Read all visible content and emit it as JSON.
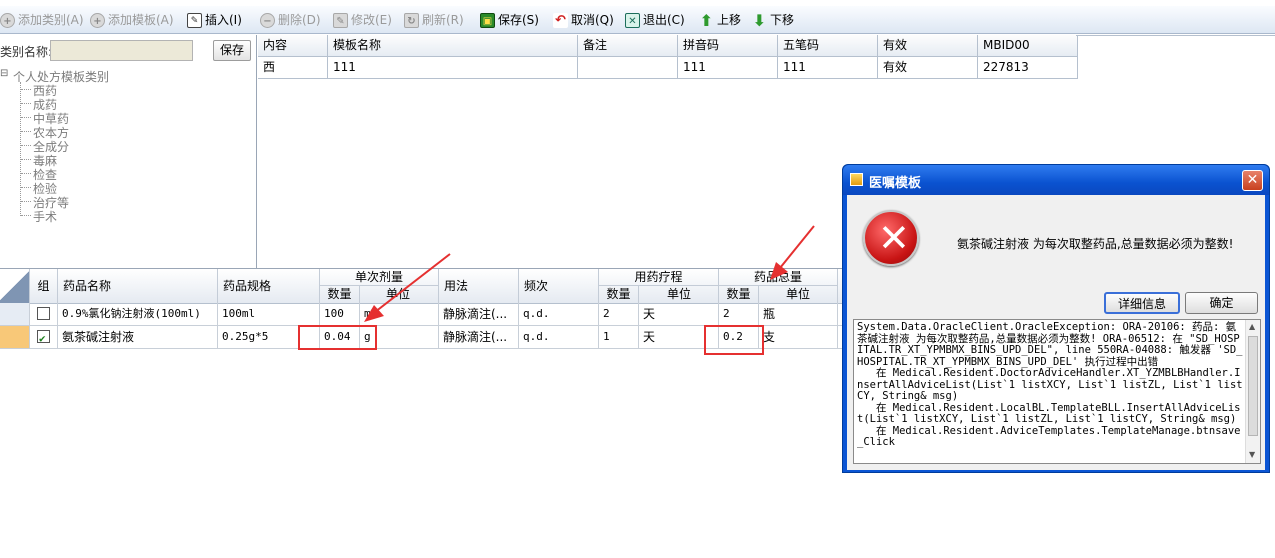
{
  "toolbar": {
    "add_category": "添加类别(A)",
    "add_template": "添加模板(A)",
    "insert": "插入(I)",
    "delete": "删除(D)",
    "modify": "修改(E)",
    "refresh": "刷新(R)",
    "save": "保存(S)",
    "cancel": "取消(Q)",
    "exit": "退出(C)",
    "move_up": "上移",
    "move_down": "下移"
  },
  "category": {
    "label": "类别名称:",
    "input_value": "",
    "save_label": "保存"
  },
  "tree": {
    "root": "个人处方模板类别",
    "children": [
      "西药",
      "成药",
      "中草药",
      "农本方",
      "全成分",
      "毒麻",
      "检查",
      "检验",
      "治疗等",
      "手术"
    ]
  },
  "top_grid": {
    "headers": [
      "内容",
      "模板名称",
      "备注",
      "拼音码",
      "五笔码",
      "有效",
      "MBID00"
    ],
    "rows": [
      [
        "西",
        "111",
        "",
        "111",
        "111",
        "有效",
        "227813"
      ]
    ]
  },
  "bottom_grid": {
    "headers": {
      "group": "组",
      "drug_name": "药品名称",
      "spec": "药品规格",
      "single_dose": "单次剂量",
      "qty": "数量",
      "unit": "单位",
      "usage": "用法",
      "freq": "频次",
      "course": "用药疗程",
      "total": "药品总量"
    },
    "rows": [
      {
        "checked": false,
        "drug_name": "0.9%氯化钠注射液(100ml)",
        "spec": "100ml",
        "dose_qty": "100",
        "dose_unit": "ml",
        "usage": "静脉滴注(...",
        "freq": "q.d.",
        "course_qty": "2",
        "course_unit": "天",
        "total_qty": "2",
        "total_unit": "瓶"
      },
      {
        "checked": true,
        "drug_name": "氨茶碱注射液",
        "spec": "0.25g*5",
        "dose_qty": "0.04",
        "dose_unit": "g",
        "usage": "静脉滴注(...",
        "freq": "q.d.",
        "course_qty": "1",
        "course_unit": "天",
        "total_qty": "0.2",
        "total_unit": "支"
      }
    ]
  },
  "dialog": {
    "title": "医嘱模板",
    "message": "氨茶碱注射液 为每次取整药品,总量数据必须为整数!",
    "detail_button": "详细信息",
    "ok_button": "确定",
    "detail_text": "System.Data.OracleClient.OracleException: ORA-20106: 药品: 氨茶碱注射液 为每次取整药品,总量数据必须为整数! ORA-06512: 在 \"SD_HOSPITAL.TR_XT_YPMBMX_BINS_UPD_DEL\", line 550RA-04088: 触发器 'SD_HOSPITAL.TR_XT_YPMBMX_BINS_UPD_DEL' 执行过程中出错\n   在 Medical.Resident.DoctorAdviceHandler.XT_YZMBLBHandler.InsertAllAdviceList(List`1 listXCY, List`1 listZL, List`1 listCY, String& msg)\n   在 Medical.Resident.LocalBL.TemplateBLL.InsertAllAdviceList(List`1 listXCY, List`1 listZL, List`1 listCY, String& msg)\n   在 Medical.Resident.AdviceTemplates.TemplateManage.btnsave_Click"
  }
}
